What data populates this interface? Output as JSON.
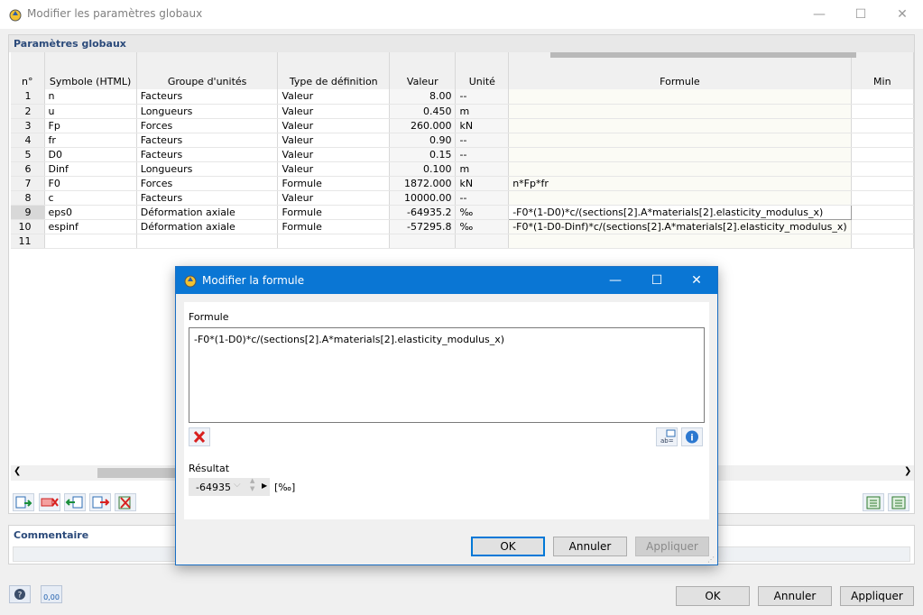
{
  "main": {
    "title": "Modifier les paramètres globaux",
    "section_title": "Paramètres globaux",
    "columns": [
      "n°",
      "Symbole (HTML)",
      "Groupe d'unités",
      "Type de définition",
      "Valeur",
      "Unité",
      "Formule",
      "Min"
    ],
    "rows": [
      {
        "n": "1",
        "symbol": "n",
        "group": "Facteurs",
        "type": "Valeur",
        "value": "8.00",
        "unit": "--",
        "formula": ""
      },
      {
        "n": "2",
        "symbol": "u",
        "group": "Longueurs",
        "type": "Valeur",
        "value": "0.450",
        "unit": "m",
        "formula": ""
      },
      {
        "n": "3",
        "symbol": "Fp",
        "group": "Forces",
        "type": "Valeur",
        "value": "260.000",
        "unit": "kN",
        "formula": ""
      },
      {
        "n": "4",
        "symbol": "fr",
        "group": "Facteurs",
        "type": "Valeur",
        "value": "0.90",
        "unit": "--",
        "formula": ""
      },
      {
        "n": "5",
        "symbol": "D0",
        "group": "Facteurs",
        "type": "Valeur",
        "value": "0.15",
        "unit": "--",
        "formula": ""
      },
      {
        "n": "6",
        "symbol": "Dinf",
        "group": "Longueurs",
        "type": "Valeur",
        "value": "0.100",
        "unit": "m",
        "formula": ""
      },
      {
        "n": "7",
        "symbol": "F0",
        "group": "Forces",
        "type": "Formule",
        "value": "1872.000",
        "unit": "kN",
        "formula": "n*Fp*fr"
      },
      {
        "n": "8",
        "symbol": "c",
        "group": "Facteurs",
        "type": "Valeur",
        "value": "10000.00",
        "unit": "--",
        "formula": ""
      },
      {
        "n": "9",
        "symbol": "eps0",
        "group": "Déformation axiale",
        "type": "Formule",
        "value": "-64935.2",
        "unit": "‰",
        "formula": "-F0*(1-D0)*c/(sections[2].A*materials[2].elasticity_modulus_x)"
      },
      {
        "n": "10",
        "symbol": "espinf",
        "group": "Déformation axiale",
        "type": "Formule",
        "value": "-57295.8",
        "unit": "‰",
        "formula": "-F0*(1-D0-Dinf)*c/(sections[2].A*materials[2].elasticity_modulus_x)"
      },
      {
        "n": "11",
        "symbol": "",
        "group": "",
        "type": "",
        "value": "",
        "unit": "",
        "formula": ""
      }
    ],
    "comment_label": "Commentaire",
    "ok_label": "OK",
    "cancel_label": "Annuler",
    "apply_label": "Appliquer",
    "status_value": "0,00"
  },
  "dialog": {
    "title": "Modifier la formule",
    "formula_label": "Formule",
    "formula_text": "-F0*(1-D0)*c/(sections[2].A*materials[2].elasticity_modulus_x)",
    "result_label": "Résultat",
    "result_value": "-64935",
    "result_unit": "[‰]",
    "ok_label": "OK",
    "cancel_label": "Annuler",
    "apply_label": "Appliquer"
  },
  "colors": {
    "accent": "#0078d7",
    "titlebar_active": "#0a76d4",
    "delete_red": "#d82020"
  }
}
